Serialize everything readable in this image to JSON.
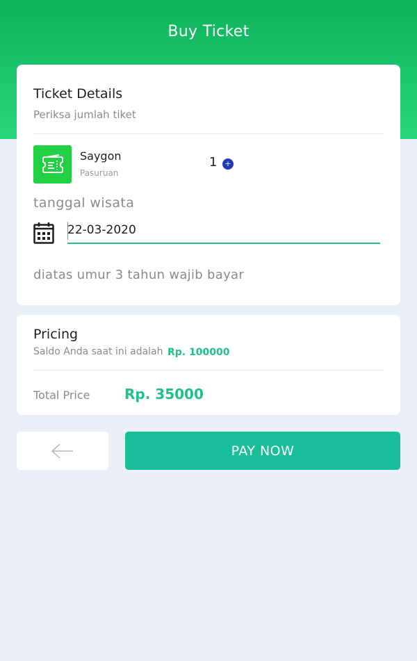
{
  "header": {
    "title": "Buy Ticket"
  },
  "ticket_details": {
    "title": "Ticket Details",
    "subtitle": "Periksa jumlah tiket",
    "place_name": "Saygon",
    "place_city": "Pasuruan",
    "quantity": "1",
    "plus_symbol": "+",
    "date_label": "tanggal wisata",
    "date_value": "22-03-2020",
    "age_note": "diatas umur 3 tahun wajib bayar"
  },
  "pricing": {
    "title": "Pricing",
    "balance_label": "Saldo Anda saat ini adalah",
    "balance_value": "Rp.  100000",
    "total_label": "Total Price",
    "total_value": "Rp. 35000"
  },
  "actions": {
    "back_icon": "arrow-left-icon",
    "pay_label": "PAY NOW"
  },
  "colors": {
    "header_top": "#0db25a",
    "header_bottom": "#27d67c",
    "accent": "#1fc08e",
    "pay_button": "#19be9b",
    "ticket_icon_bg": "#22d143",
    "plus_button": "#2236b8",
    "page_bg": "#ebf0f7"
  }
}
